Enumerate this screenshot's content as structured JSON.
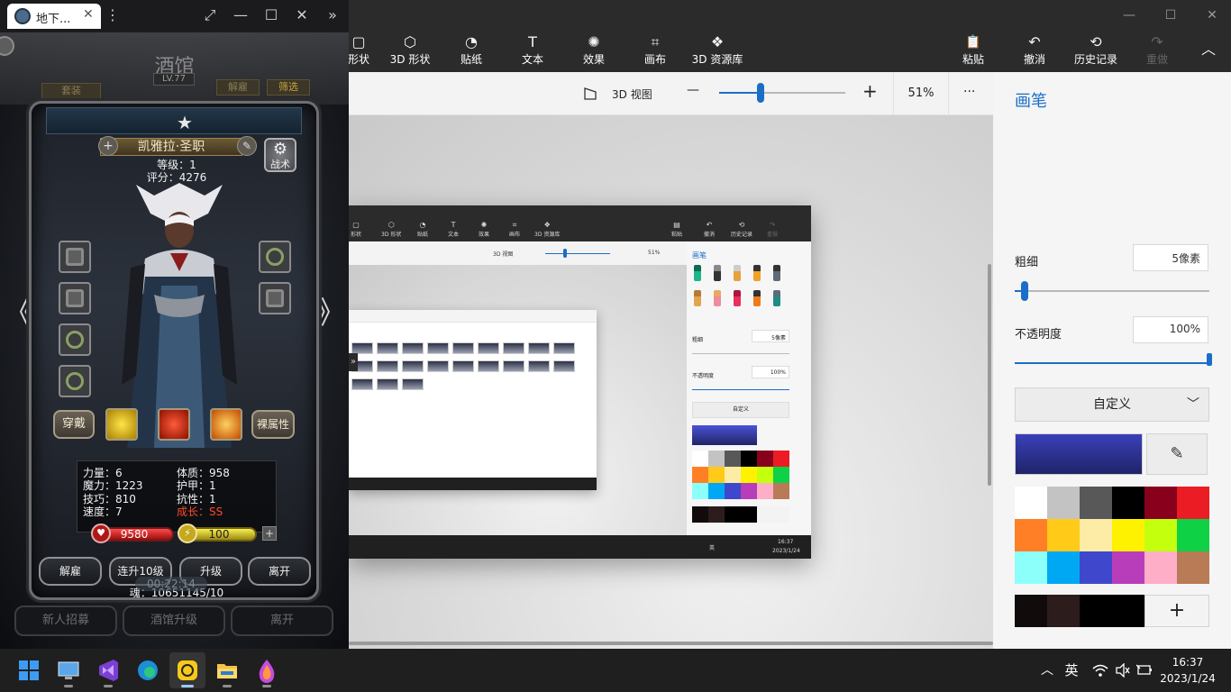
{
  "emulator": {
    "tab_title": "地下...",
    "tab_close": "✕",
    "menu": "⋮",
    "controls": [
      "⤢",
      "—",
      "☐",
      "✕",
      "»"
    ]
  },
  "game": {
    "tavern_name": "酒馆",
    "tavern_level": "LV.77",
    "tab_recruit": "套装",
    "tab_dismiss": "解雇",
    "tab_filter": "筛选",
    "hero": {
      "name": "凯雅拉·圣职",
      "level": "等级：1",
      "score": "评分：4276",
      "tactics": "战术"
    },
    "actions": {
      "wear": "穿戴",
      "naked_attr": "裸属性"
    },
    "stats": {
      "strength": "力量：6",
      "constitution": "体质：958",
      "magic": "魔力：1223",
      "armor": "护甲：1",
      "skill": "技巧：810",
      "resist": "抗性：1",
      "speed": "速度：7",
      "growth": "成长：SS"
    },
    "hp": "9580",
    "energy": "100",
    "energy_plus": "+",
    "bottom_buttons": [
      "解雇",
      "连升10级",
      "升级",
      "离开"
    ],
    "soul": "魂：10651145/10",
    "timer": "00:22:14",
    "footer_buttons": [
      "新人招募",
      "酒馆升级",
      "离开"
    ],
    "nav_prev": "《",
    "nav_next": "》",
    "colors": {
      "growth": "#ff4a2a",
      "hp": "#d42a2a",
      "energy": "#e6d22a"
    }
  },
  "paint": {
    "window_controls": [
      "—",
      "☐",
      "✕"
    ],
    "ribbon": [
      {
        "label": "形状",
        "icon": "▢"
      },
      {
        "label": "3D 形状",
        "icon": "⬡"
      },
      {
        "label": "贴纸",
        "icon": "◔"
      },
      {
        "label": "文本",
        "icon": "T"
      },
      {
        "label": "效果",
        "icon": "✺"
      },
      {
        "label": "画布",
        "icon": "⌗"
      },
      {
        "label": "3D 资源库",
        "icon": "❖"
      }
    ],
    "ribbon_right": [
      {
        "label": "粘贴",
        "icon": "📋"
      },
      {
        "label": "撤消",
        "icon": "↶"
      },
      {
        "label": "历史记录",
        "icon": "⟲"
      },
      {
        "label": "重做",
        "icon": "↷"
      }
    ],
    "collapse": "︿",
    "view_3d": "3D 视图",
    "zoom_minus": "—",
    "zoom_plus": "+",
    "zoom_level": "51%",
    "zoom_fraction": 0.33,
    "more": "···",
    "panel_title": "画笔",
    "thickness_label": "粗细",
    "thickness_value": "5像素",
    "thickness_fraction": 0.05,
    "opacity_label": "不透明度",
    "opacity_value": "100%",
    "opacity_fraction": 1.0,
    "color_mode": "自定义",
    "color_mode_chevron": "﹀",
    "eyedropper": "✎",
    "current_color": "#3a40b8",
    "palette": [
      "#ffffff",
      "#c3c3c3",
      "#585858",
      "#000000",
      "#88001b",
      "#ec1c24",
      "#ff7f27",
      "#ffca18",
      "#fdeca6",
      "#fff200",
      "#c4ff0e",
      "#0ed145",
      "#8cfffb",
      "#00a8f3",
      "#3f48cc",
      "#b83dba",
      "#ffaec8",
      "#b97a56"
    ],
    "custom_colors": [
      "#120b0c",
      "#2c1d1c",
      "#000000",
      "#000000"
    ],
    "add_color": "+",
    "brush_icons": [
      "marker-icon",
      "calligraphy-pen-icon",
      "oil-brush-icon",
      "watercolor-brush-icon",
      "pixel-pen-icon",
      "pencil-icon",
      "eraser-icon",
      "crayon-icon",
      "spray-can-icon",
      "fill-bucket-icon"
    ],
    "nested": {
      "ribbon": [
        "形状",
        "3D 形状",
        "贴纸",
        "文本",
        "效果",
        "画布",
        "3D 资源库"
      ],
      "ribbon_right": [
        "粘贴",
        "撤消",
        "历史记录",
        "重做"
      ],
      "view_3d": "3D 视图",
      "zoom": "51%",
      "panel_title": "画笔",
      "thickness_label": "粗细",
      "thickness_value": "5像素",
      "opacity_label": "不透明度",
      "opacity_value": "100%",
      "mode": "自定义",
      "time": "16:37",
      "date": "2023/1/24",
      "ime": "英"
    }
  },
  "taskbar": {
    "apps": [
      "start-icon",
      "desktop-icon",
      "visual-studio-icon",
      "edge-icon",
      "emulator-icon",
      "file-explorer-icon",
      "paint-3d-icon"
    ],
    "tray": {
      "chevron": "︿",
      "ime": "英",
      "wifi": "wifi-icon",
      "volume": "volume-icon",
      "battery": "battery-icon"
    },
    "time": "16:37",
    "date": "2023/1/24"
  }
}
